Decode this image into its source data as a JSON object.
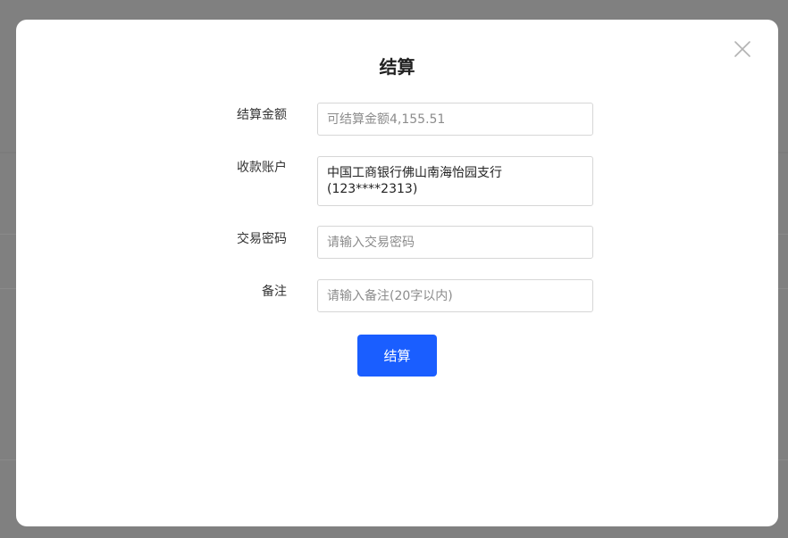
{
  "dialog": {
    "title": "结算",
    "close_icon": "close-icon"
  },
  "form": {
    "amount": {
      "label": "结算金额",
      "value": "",
      "placeholder": "可结算金额4,155.51"
    },
    "account": {
      "label": "收款账户",
      "bank_name": "中国工商银行佛山南海怡园支行",
      "account_number": "(123****2313)"
    },
    "password": {
      "label": "交易密码",
      "value": "",
      "placeholder": "请输入交易密码"
    },
    "remark": {
      "label": "备注",
      "value": "",
      "placeholder": "请输入备注(20字以内)"
    }
  },
  "submit": {
    "label": "结算"
  },
  "colors": {
    "primary": "#1a5eff",
    "overlay": "#808080",
    "border": "#d6d6d6"
  }
}
